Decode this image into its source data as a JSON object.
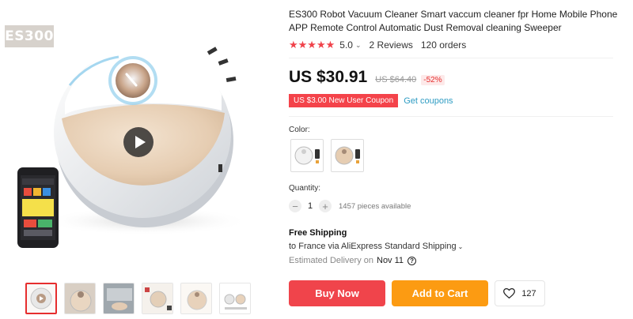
{
  "gallery": {
    "brand_tag": "ES300",
    "play_icon": "play-icon",
    "thumbnail_count": 6
  },
  "product": {
    "title": "ES300 Robot Vacuum Cleaner Smart vaccum cleaner fpr Home Mobile Phone APP Remote Control Automatic Dust Removal cleaning Sweeper",
    "rating": {
      "stars": "★★★★★",
      "score": "5.0",
      "reviews": "2 Reviews",
      "orders": "120 orders"
    },
    "price": {
      "current": "US $30.91",
      "original": "US $64.40",
      "discount": "-52%"
    },
    "coupon": {
      "label": "US $3.00 New User Coupon",
      "link": "Get coupons"
    },
    "color": {
      "label": "Color:",
      "options": [
        "white",
        "gold"
      ]
    },
    "quantity": {
      "label": "Quantity:",
      "minus": "−",
      "value": "1",
      "plus": "+",
      "available": "1457 pieces available"
    },
    "shipping": {
      "title": "Free Shipping",
      "line": "to France via AliExpress Standard Shipping",
      "delivery_label": "Estimated Delivery on",
      "delivery_date": "Nov 11"
    },
    "actions": {
      "buy_now": "Buy Now",
      "add_to_cart": "Add to Cart",
      "wishlist_count": "127"
    }
  },
  "colors": {
    "accent_red": "#f0444b",
    "cart_orange": "#fc9b12",
    "link_blue": "#2e9cc3",
    "star_red": "#f0424a"
  }
}
